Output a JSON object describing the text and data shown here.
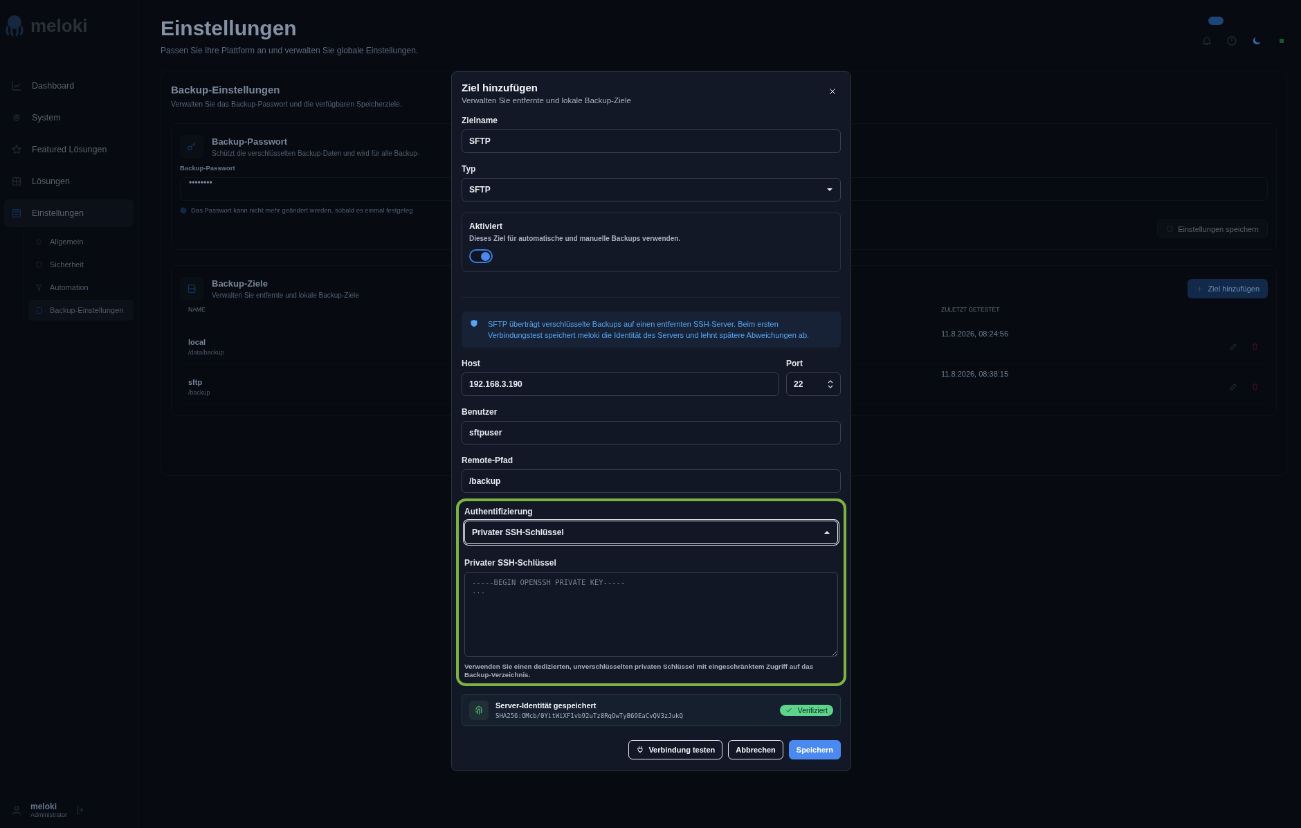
{
  "app": {
    "logo": "meloki"
  },
  "sidebar": {
    "items": [
      {
        "label": "Dashboard",
        "selected": false
      },
      {
        "label": "System",
        "selected": false
      },
      {
        "label": "Featured Lösungen",
        "selected": false
      },
      {
        "label": "Lösungen",
        "selected": false
      },
      {
        "label": "Einstellungen",
        "selected": true,
        "children": [
          {
            "label": "Allgemein",
            "selected": false
          },
          {
            "label": "Sicherheit",
            "selected": false
          },
          {
            "label": "Automation",
            "selected": false
          },
          {
            "label": "Backup-Einstellungen",
            "selected": true
          }
        ]
      }
    ],
    "user": {
      "name": "meloki",
      "role": "Administrator"
    }
  },
  "page": {
    "title": "Einstellungen",
    "subtitle": "Passen Sie Ihre Plattform an und verwalten Sie globale Einstellungen."
  },
  "backup_settings": {
    "title": "Backup-Einstellungen",
    "subtitle": "Verwalten Sie das Backup-Passwort und die verfügbaren Speicherziele.",
    "password_card": {
      "title": "Backup-Passwort",
      "description": "Schützt die verschlüsselten Backup-Daten und wird für alle Backup-",
      "field_label": "Backup-Passwort",
      "field_value": "••••••••",
      "hint": "Das Passwort kann nicht mehr geändert werden, sobald es einmal festgeleg"
    },
    "save_button": "Einstellungen speichern",
    "targets": {
      "title": "Backup-Ziele",
      "subtitle": "Verwalten Sie entfernte und lokale Backup-Ziele",
      "add_button": "Ziel hinzufügen",
      "columns": [
        "NAME",
        "ZULETZT GETESTET"
      ],
      "rows": [
        {
          "name": "local",
          "path": "/data/backup",
          "last_tested": "11.8.2026, 08:24:56"
        },
        {
          "name": "sftp",
          "path": "/backup",
          "last_tested": "11.8.2026, 08:38:15"
        }
      ]
    }
  },
  "dialog": {
    "title": "Ziel hinzufügen",
    "subtitle": "Verwalten Sie entfernte und lokale Backup-Ziele",
    "name_field": {
      "label": "Zielname",
      "value": "SFTP"
    },
    "type_field": {
      "label": "Typ",
      "value": "SFTP",
      "open": false
    },
    "enabled": {
      "title": "Aktiviert",
      "description": "Dieses Ziel für automatische und manuelle Backups verwenden.",
      "on": true
    },
    "info": "SFTP überträgt verschlüsselte Backups auf einen entfernten SSH-Server. Beim ersten Verbindungstest speichert meloki die Identität des Servers und lehnt spätere Abweichungen ab.",
    "host": {
      "label": "Host",
      "value": "192.168.3.190"
    },
    "port": {
      "label": "Port",
      "value": "22"
    },
    "user": {
      "label": "Benutzer",
      "value": "sftpuser"
    },
    "remote_path": {
      "label": "Remote-Pfad",
      "value": "/backup"
    },
    "auth": {
      "label": "Authentifizierung",
      "value": "Privater SSH-Schlüssel",
      "open": true,
      "highlighted": true
    },
    "private_key": {
      "label": "Privater SSH-Schlüssel",
      "placeholder": "-----BEGIN OPENSSH PRIVATE KEY-----\n...",
      "hint": "Verwenden Sie einen dedizierten, unverschlüsselten privaten Schlüssel mit eingeschränktem Zugriff auf das Backup-Verzeichnis."
    },
    "server_identity": {
      "title": "Server-Identität gespeichert",
      "fingerprint": "SHA256:OMcb/0YitWiXF1vb92uTz8RqOwTyB69EaCvQV3zJukQ",
      "badge": "Verifiziert"
    },
    "buttons": [
      {
        "label": "Verbindung testen",
        "kind": "outline"
      },
      {
        "label": "Abbrechen",
        "kind": "outline"
      },
      {
        "label": "Speichern",
        "kind": "primary"
      }
    ]
  }
}
